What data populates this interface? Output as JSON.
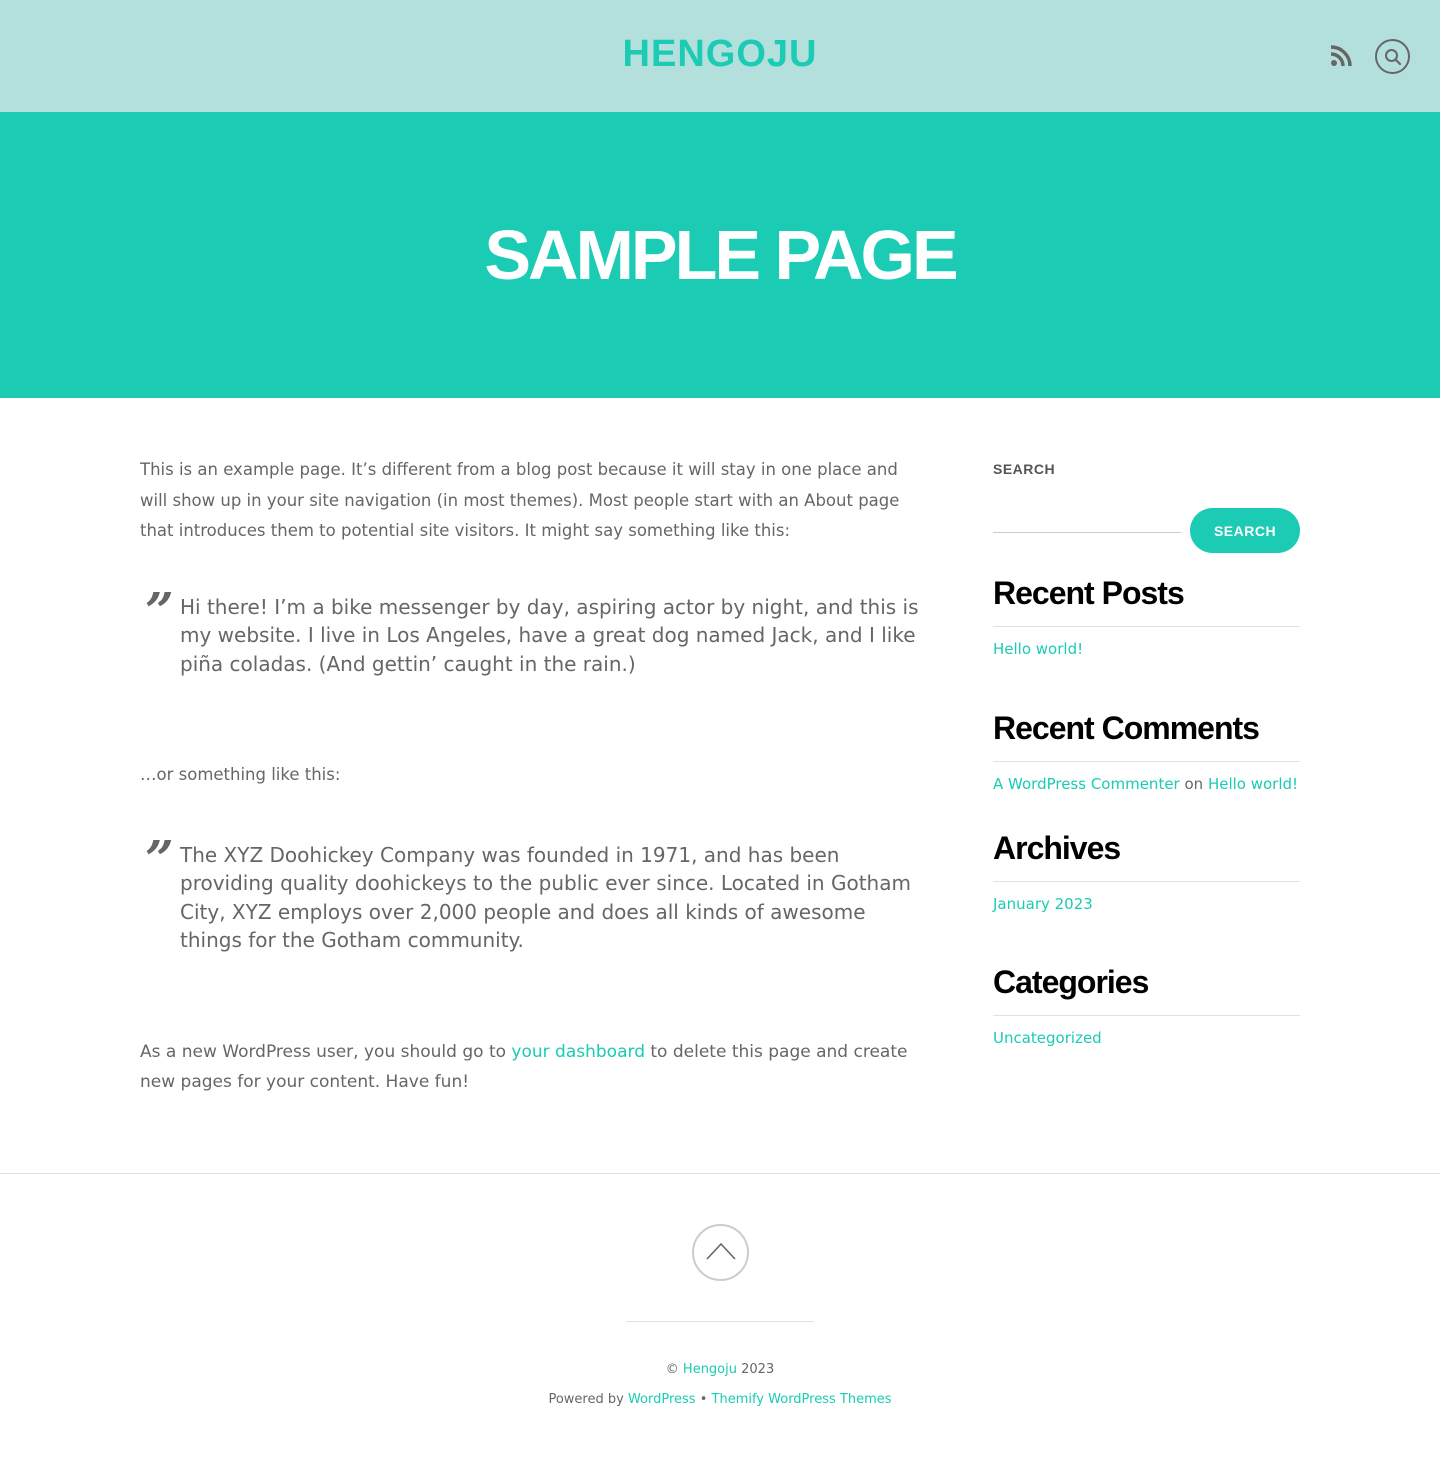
{
  "header": {
    "site_title": "HENGOJU",
    "rss_icon": "rss-icon",
    "search_icon": "search-icon"
  },
  "banner": {
    "page_title": "SAMPLE PAGE"
  },
  "content": {
    "intro": "This is an example page. It’s different from a blog post because it will stay in one place and will show up in your site navigation (in most themes). Most people start with an About page that introduces them to potential site visitors. It might say something like this:",
    "quote1": "Hi there! I’m a bike messenger by day, aspiring actor by night, and this is my website. I live in Los Angeles, have a great dog named Jack, and I like piña coladas. (And gettin’ caught in the rain.)",
    "or_text": "…or something like this:",
    "quote2": "The XYZ Doohickey Company was founded in 1971, and has been providing quality doohickeys to the public ever since. Located in Gotham City, XYZ employs over 2,000 people and does all kinds of awesome things for the Gotham community.",
    "outro_before": "As a new WordPress user, you should go to ",
    "outro_link": "your dashboard",
    "outro_after": " to delete this page and create new pages for your content. Have fun!",
    "quote_mark": "”"
  },
  "sidebar": {
    "search_label": "SEARCH",
    "search_placeholder": "",
    "search_value": "",
    "search_button": "SEARCH",
    "recent_posts_title": "Recent Posts",
    "recent_posts": [
      "Hello world!"
    ],
    "recent_comments_title": "Recent Comments",
    "recent_comment": {
      "author": "A WordPress Commenter",
      "on": " on ",
      "post": "Hello world!"
    },
    "archives_title": "Archives",
    "archives": [
      "January 2023"
    ],
    "categories_title": "Categories",
    "categories": [
      "Uncategorized"
    ]
  },
  "footer": {
    "back_to_top_icon": "chevron-up-icon",
    "copyright_symbol": "© ",
    "copyright_site": "Hengoju",
    "copyright_year": " 2023",
    "powered_by": "Powered by ",
    "wordpress_link": "WordPress",
    "separator": " • ",
    "themify_link": "Themify WordPress Themes"
  },
  "colors": {
    "header_bg": "#b3e0dd",
    "accent": "#1bcbb3",
    "text": "#666666",
    "heading": "#000000"
  }
}
